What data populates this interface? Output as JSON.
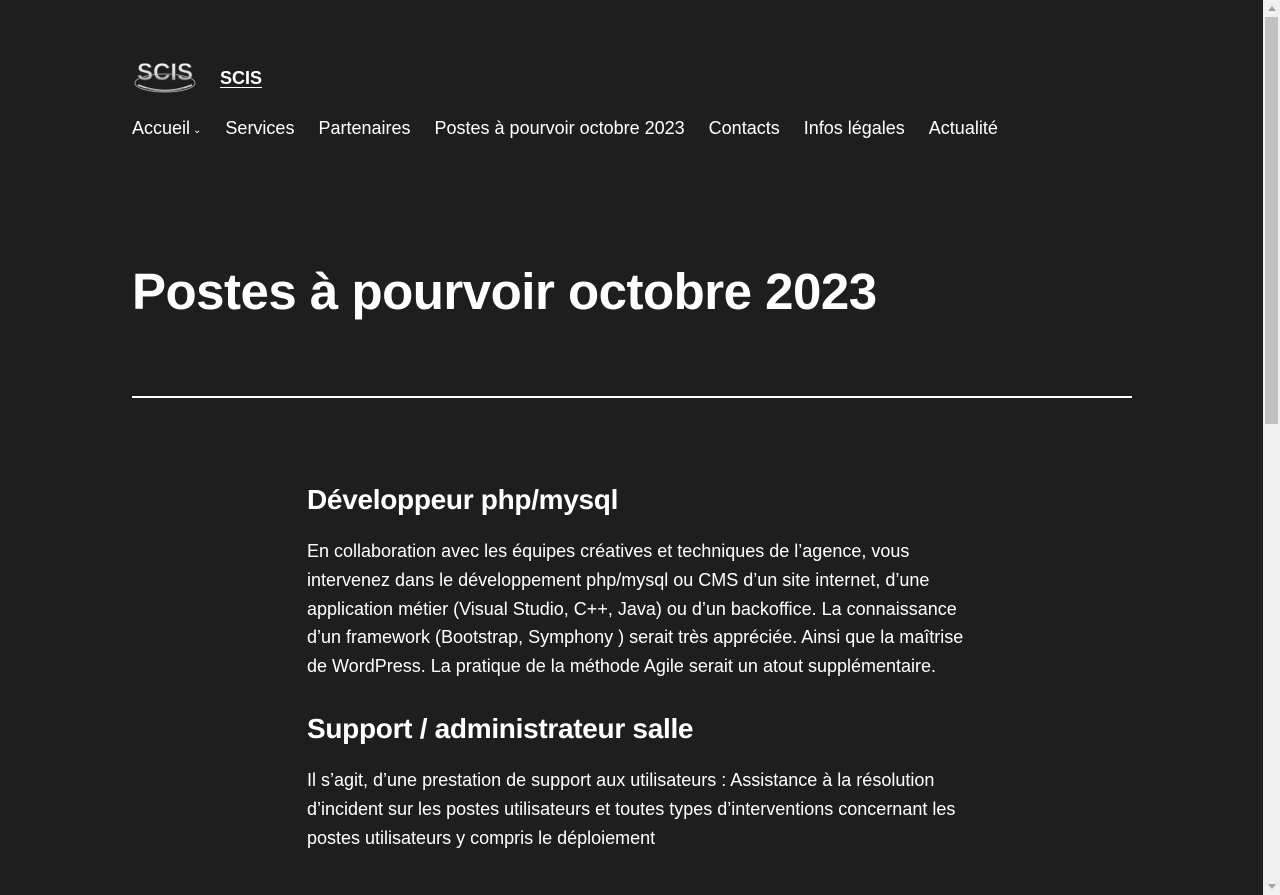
{
  "site": {
    "title": "SCIS",
    "logo_text": "SCIS"
  },
  "nav": [
    {
      "label": "Accueil",
      "has_submenu": true
    },
    {
      "label": "Services"
    },
    {
      "label": "Partenaires"
    },
    {
      "label": "Postes à pourvoir octobre 2023"
    },
    {
      "label": "Contacts"
    },
    {
      "label": "Infos légales"
    },
    {
      "label": "Actualité"
    }
  ],
  "page": {
    "title": "Postes à pourvoir octobre 2023"
  },
  "jobs": [
    {
      "title": "Développeur php/mysql",
      "description": "En collaboration avec les équipes créatives et techniques de l’agence, vous intervenez dans le développement php/mysql  ou CMS d’un site internet, d’une application métier (Visual Studio, C++, Java) ou d’un backoffice. La connaissance d’un framework (Bootstrap,  Symphony ) serait très appréciée. Ainsi que la maîtrise de WordPress. La pratique de la méthode Agile serait un atout supplémentaire."
    },
    {
      "title": "Support / administrateur salle",
      "description": "Il s’agit, d’une prestation de support aux utilisateurs : Assistance à la résolution d’incident sur les postes utilisateurs et toutes types d’interventions concernant les postes utilisateurs y compris le déploiement"
    }
  ],
  "colors": {
    "background": "#1e1e1f",
    "text": "#ffffff"
  }
}
